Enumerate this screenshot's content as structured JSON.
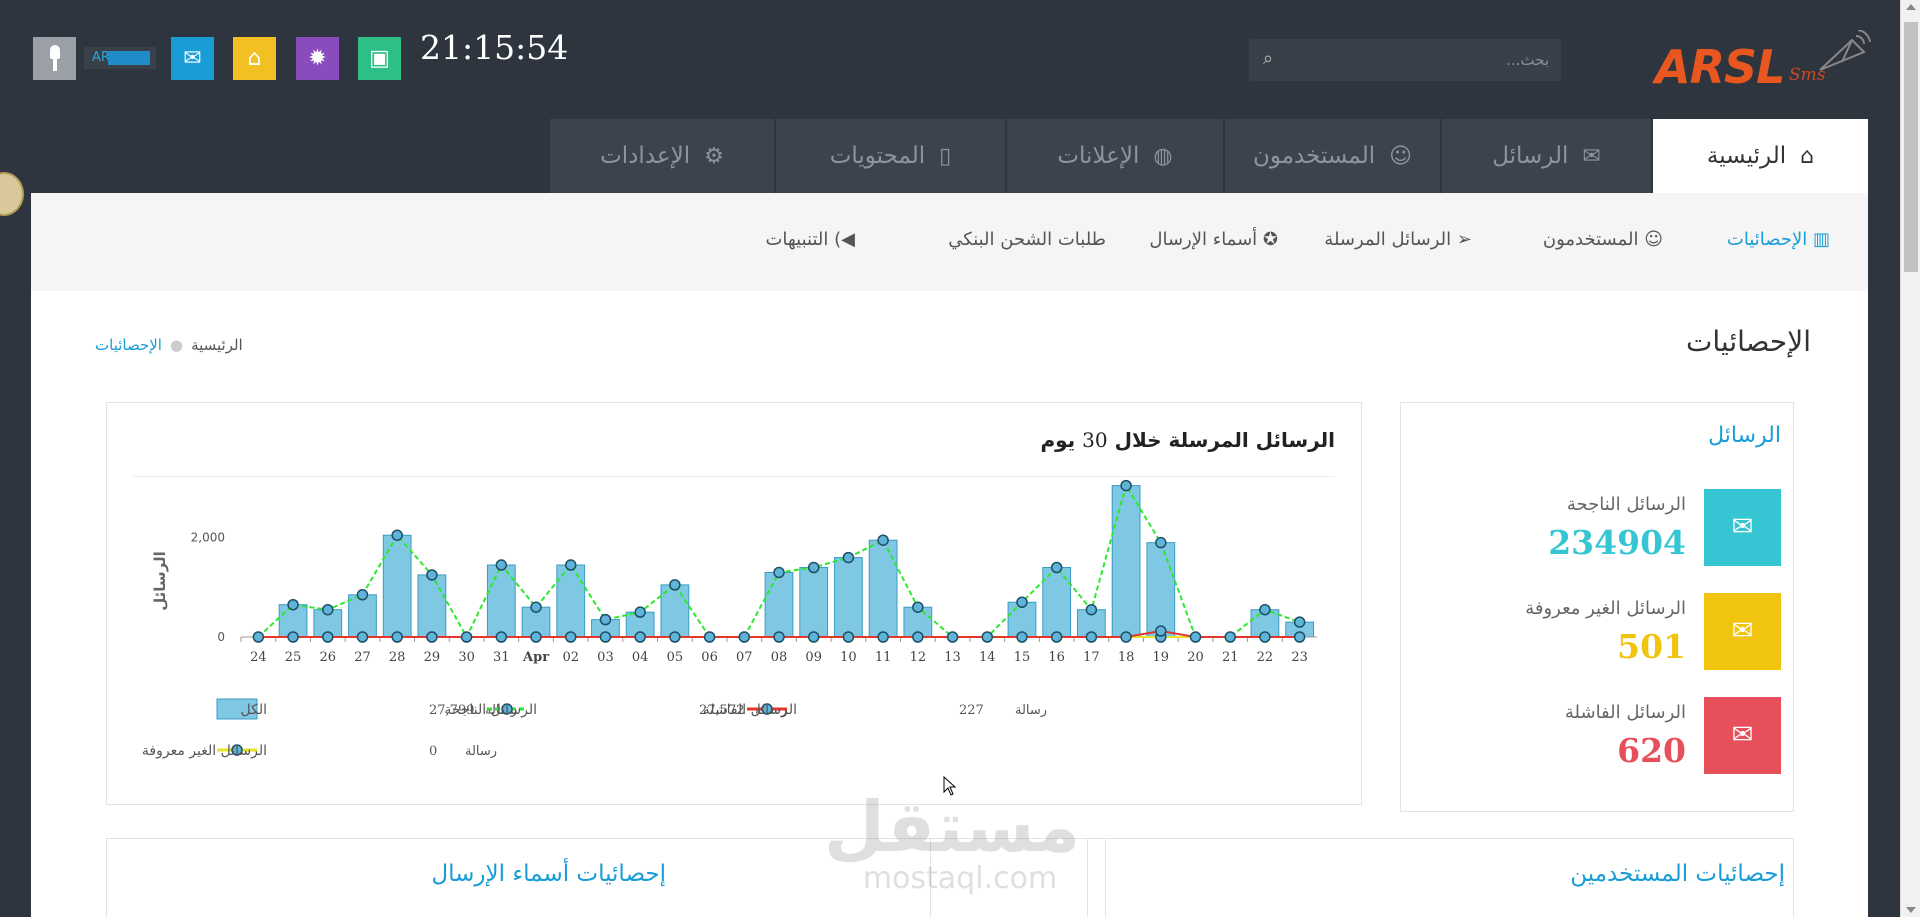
{
  "topbar": {
    "username": "AR",
    "clock": "21:15:54",
    "search_placeholder": "بحث...",
    "quick_icons": [
      "envelope-open-icon",
      "tag-icon",
      "badge-icon",
      "money-icon"
    ]
  },
  "logo": {
    "brand": "ARSL",
    "suffix": "Sms"
  },
  "tabs": [
    {
      "label": "الرئيسية",
      "icon": "home-icon",
      "active": true
    },
    {
      "label": "الرسائل",
      "icon": "envelope-icon",
      "active": false
    },
    {
      "label": "المستخدمون",
      "icon": "users-icon",
      "active": false
    },
    {
      "label": "الإعلانات",
      "icon": "globe-icon",
      "active": false
    },
    {
      "label": "المحتويات",
      "icon": "book-icon",
      "active": false
    },
    {
      "label": "الإعدادات",
      "icon": "gear-icon",
      "active": false
    }
  ],
  "subnav": [
    {
      "label": "الإحصائيات",
      "icon": "bar-chart-icon",
      "active": true
    },
    {
      "label": "المستخدمون",
      "icon": "users-icon",
      "active": false
    },
    {
      "label": "الرسائل المرسلة",
      "icon": "paper-plane-icon",
      "active": false
    },
    {
      "label": "أسماء الإرسال",
      "icon": "award-icon",
      "active": false
    },
    {
      "label": "طلبات الشحن البنكي",
      "icon": "",
      "active": false
    },
    {
      "label": "التنبيهات",
      "icon": "speaker-icon",
      "active": false
    }
  ],
  "page": {
    "title": "الإحصائيات",
    "breadcrumb": [
      "الرئيسية",
      "الإحصائيات"
    ]
  },
  "stats": {
    "title": "الرسائل",
    "items": [
      {
        "label": "الرسائل الناجحة",
        "value": "234904",
        "color": "#36c6d3"
      },
      {
        "label": "الرسائل الغير معروفة",
        "value": "501",
        "color": "#f1c40f"
      },
      {
        "label": "الرسائل الفاشلة",
        "value": "620",
        "color": "#e7505a"
      }
    ]
  },
  "chart_title_parts": [
    "الرسائل المرسلة خلال",
    "30",
    "يوم"
  ],
  "chart_data": {
    "type": "bar",
    "title": "الرسائل المرسلة خلال 30 يوم",
    "ylabel": "الرسائل",
    "ylim": [
      0,
      2800
    ],
    "yticks": [
      "0",
      "2,000"
    ],
    "categories": [
      "24",
      "25",
      "26",
      "27",
      "28",
      "29",
      "30",
      "31",
      "Apr",
      "02",
      "03",
      "04",
      "05",
      "06",
      "07",
      "08",
      "09",
      "10",
      "11",
      "12",
      "13",
      "14",
      "15",
      "16",
      "17",
      "18",
      "19",
      "20",
      "21",
      "22",
      "23"
    ],
    "series": [
      {
        "name": "الكل",
        "type": "bar",
        "color": "#7ec8e3",
        "values": [
          0,
          650,
          550,
          850,
          2050,
          1250,
          0,
          1450,
          600,
          1450,
          350,
          500,
          1050,
          0,
          0,
          1300,
          1400,
          1600,
          1950,
          600,
          0,
          0,
          700,
          1400,
          550,
          3050,
          1900,
          0,
          0,
          550,
          300
        ]
      },
      {
        "name": "الرسائل الناجحة",
        "type": "line",
        "color": "#2ee82e",
        "values": [
          0,
          650,
          550,
          850,
          2050,
          1250,
          0,
          1450,
          600,
          1450,
          350,
          500,
          1050,
          0,
          0,
          1300,
          1400,
          1600,
          1950,
          600,
          0,
          0,
          700,
          1400,
          550,
          3050,
          1900,
          0,
          0,
          550,
          300
        ]
      },
      {
        "name": "الرسائل الفاشلة",
        "type": "line",
        "color": "#e2372a",
        "values": [
          0,
          0,
          0,
          0,
          0,
          0,
          0,
          0,
          0,
          0,
          0,
          0,
          0,
          0,
          0,
          0,
          0,
          0,
          0,
          0,
          0,
          0,
          0,
          0,
          0,
          0,
          120,
          0,
          0,
          0,
          0
        ]
      },
      {
        "name": "الرسائل الغير معروفة",
        "type": "line",
        "color": "#e5e32a",
        "values": [
          0,
          0,
          0,
          0,
          0,
          0,
          0,
          0,
          0,
          0,
          0,
          0,
          0,
          0,
          0,
          0,
          0,
          0,
          0,
          0,
          0,
          0,
          0,
          0,
          0,
          0,
          0,
          0,
          0,
          0,
          0
        ]
      }
    ],
    "legend": [
      {
        "name": "الكل",
        "total": "27,799",
        "unit": "رسالة",
        "style": "bar",
        "color": "#7ec8e3"
      },
      {
        "name": "الرسائل الناجحة",
        "total": "27,572",
        "unit": "رسالة",
        "style": "dashed",
        "color": "#2ee82e"
      },
      {
        "name": "الرسائل الفاشلة",
        "total": "227",
        "unit": "رسالة",
        "style": "line",
        "color": "#e2372a"
      },
      {
        "name": "الرسائل الغير معروفة",
        "total": "0",
        "unit": "رسالة",
        "style": "line",
        "color": "#e5e32a"
      }
    ]
  },
  "bottom": {
    "users_stats_title": "إحصائيات المستخدمين",
    "sender_names_title": "إحصائيات أسماء الإرسال"
  },
  "watermark": {
    "line1": "مستقل",
    "line2": "mostaql.com"
  }
}
